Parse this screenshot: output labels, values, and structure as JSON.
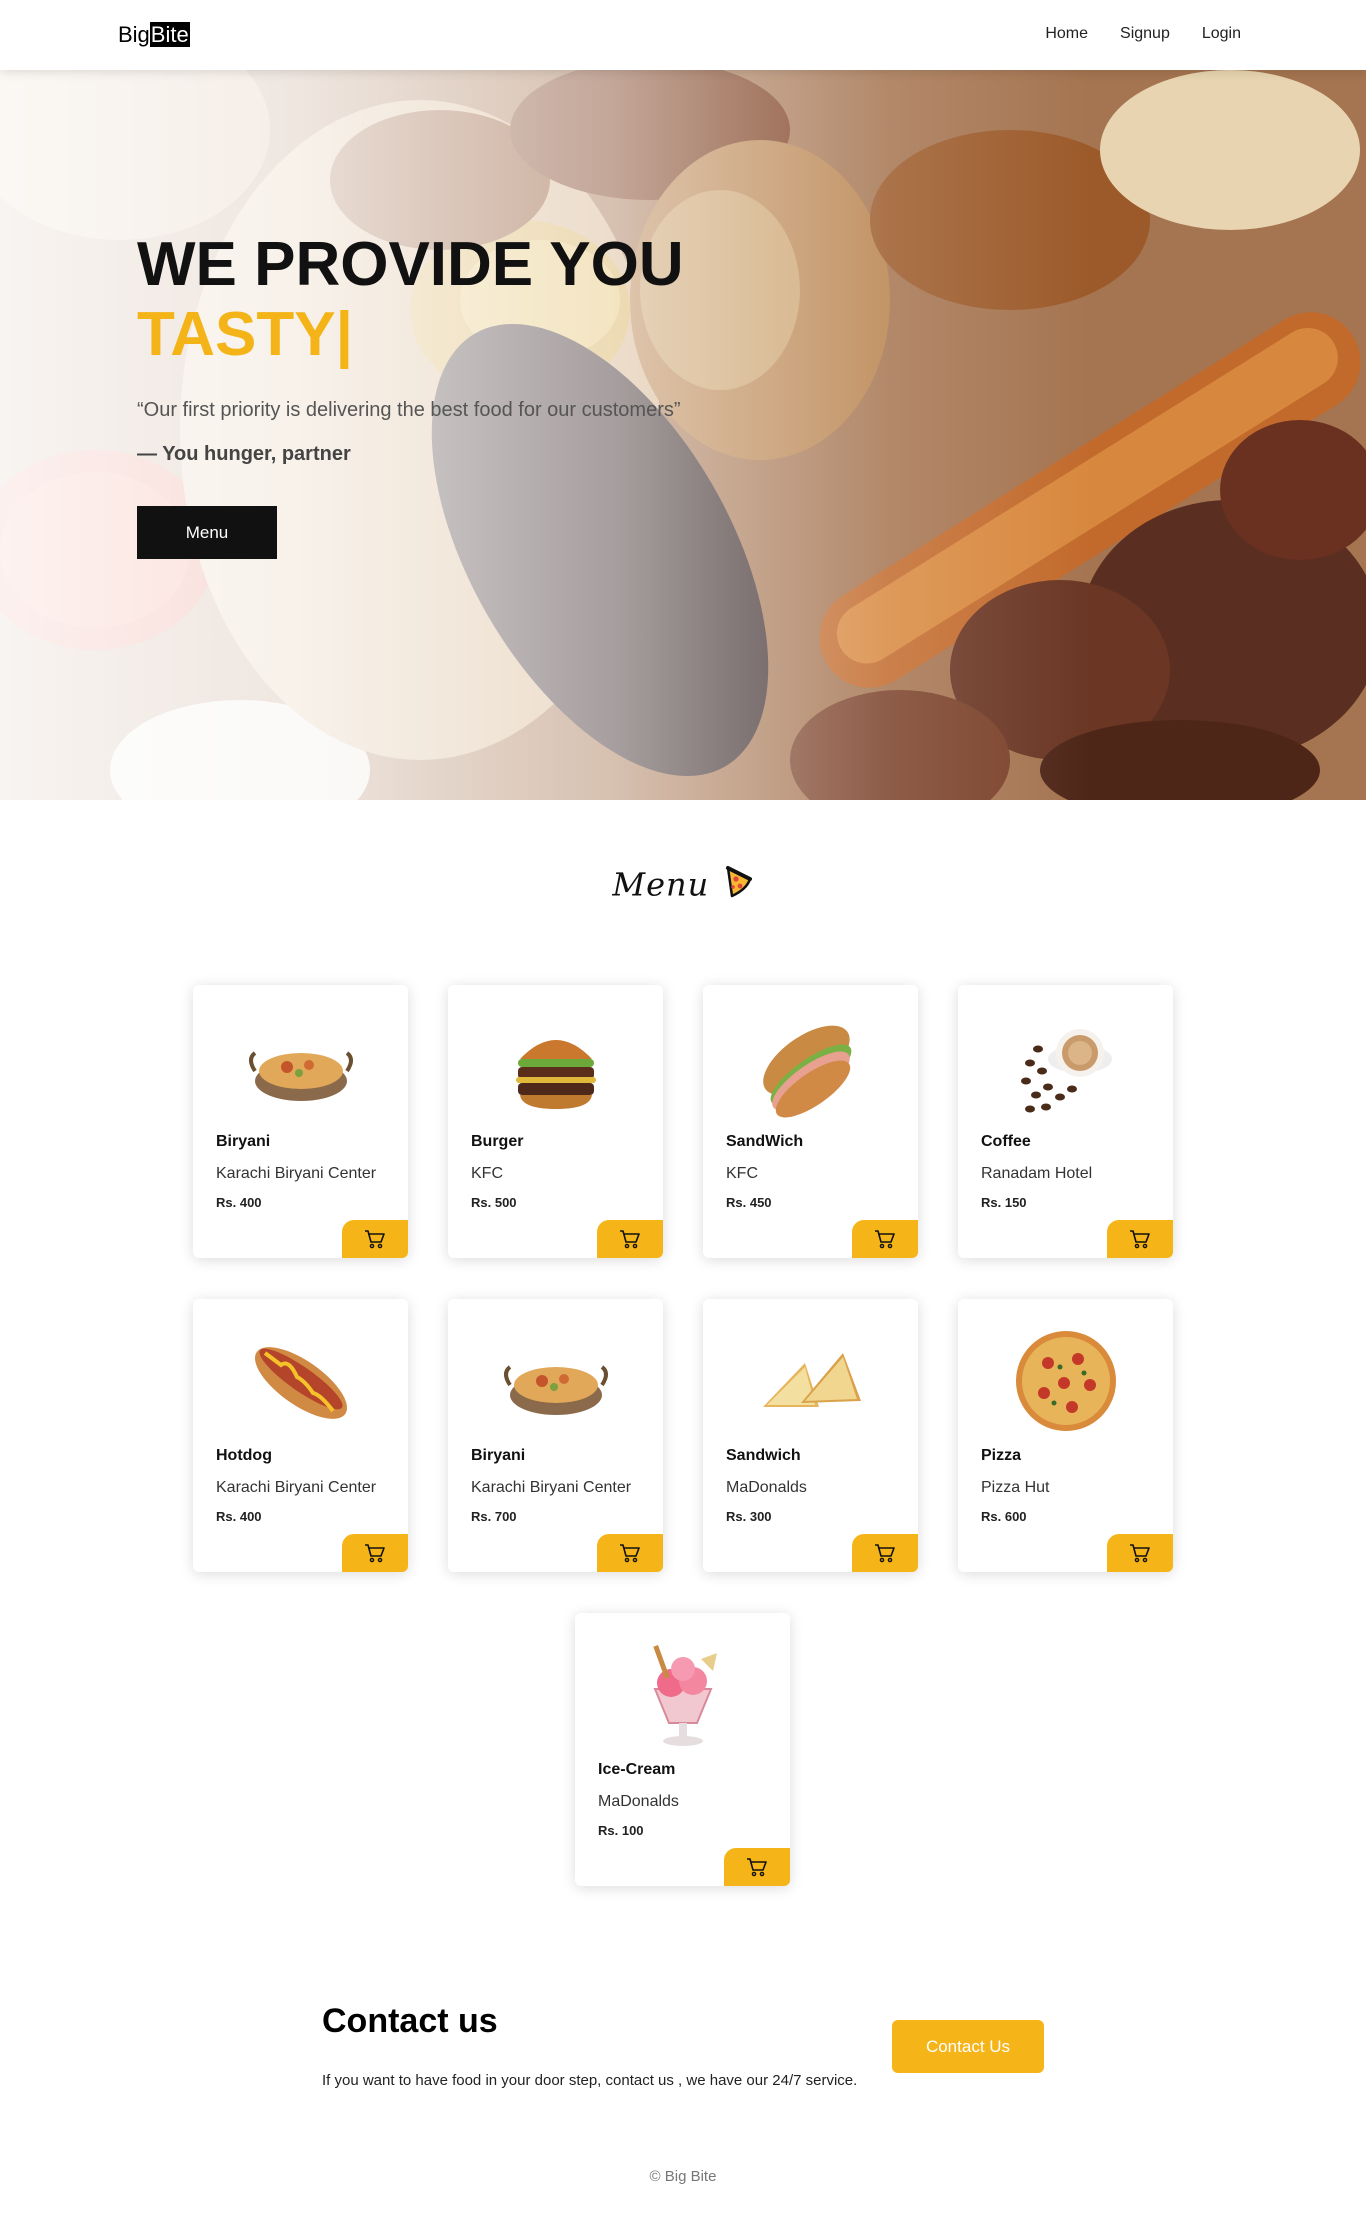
{
  "navbar": {
    "brand_part1": "Big",
    "brand_part2": "Bite",
    "links": [
      "Home",
      "Signup",
      "Login"
    ]
  },
  "hero": {
    "title_line1": "WE PROVIDE YOU",
    "title_line2": "TASTY|",
    "quote": "“Our first priority is delivering the best food for our customers”",
    "attribution": "— You hunger, partner",
    "button_label": "Menu"
  },
  "menu": {
    "heading": "Menu",
    "heading_icon": "pizza-slice-icon",
    "items": [
      {
        "name": "Biryani",
        "shop": "Karachi Biryani Center",
        "price": "Rs. 400",
        "image": "biryani"
      },
      {
        "name": "Burger",
        "shop": "KFC",
        "price": "Rs. 500",
        "image": "burger"
      },
      {
        "name": "SandWich",
        "shop": "KFC",
        "price": "Rs. 450",
        "image": "sub-sandwich"
      },
      {
        "name": "Coffee",
        "shop": "Ranadam Hotel",
        "price": "Rs. 150",
        "image": "coffee"
      },
      {
        "name": "Hotdog",
        "shop": "Karachi Biryani Center",
        "price": "Rs. 400",
        "image": "hotdog"
      },
      {
        "name": "Biryani",
        "shop": "Karachi Biryani Center",
        "price": "Rs. 700",
        "image": "biryani"
      },
      {
        "name": "Sandwich",
        "shop": "MaDonalds",
        "price": "Rs. 300",
        "image": "triangle-sandwich"
      },
      {
        "name": "Pizza",
        "shop": "Pizza Hut",
        "price": "Rs. 600",
        "image": "pizza"
      },
      {
        "name": "Ice-Cream",
        "shop": "MaDonalds",
        "price": "Rs. 100",
        "image": "ice-cream"
      }
    ],
    "cart_icon": "cart-icon"
  },
  "contact": {
    "title": "Contact us",
    "text": "If you want to have food in your door step, contact us , we have our 24/7 service.",
    "button_label": "Contact Us"
  },
  "footer": {
    "text": "© Big Bite"
  },
  "colors": {
    "accent": "#f5b417",
    "dark": "#111111"
  }
}
